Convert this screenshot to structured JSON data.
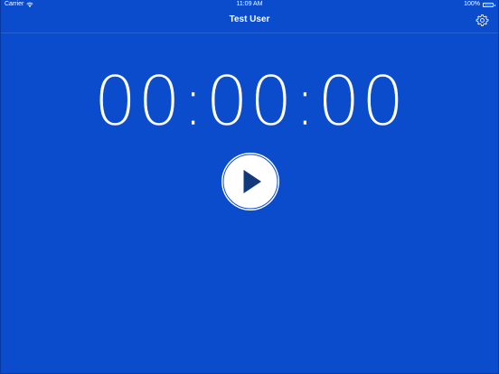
{
  "status_bar": {
    "carrier": "Carrier",
    "time": "11:09 AM",
    "battery": "100%",
    "battery_color": "#4cd964"
  },
  "nav": {
    "title": "Test User",
    "settings_icon": "gear-icon"
  },
  "timer": {
    "display": "00:00:00"
  },
  "controls": {
    "play_icon": "play-icon"
  },
  "colors": {
    "background": "#0a4ccc",
    "accent": "#ffffff",
    "play_glyph": "#123a7a"
  }
}
